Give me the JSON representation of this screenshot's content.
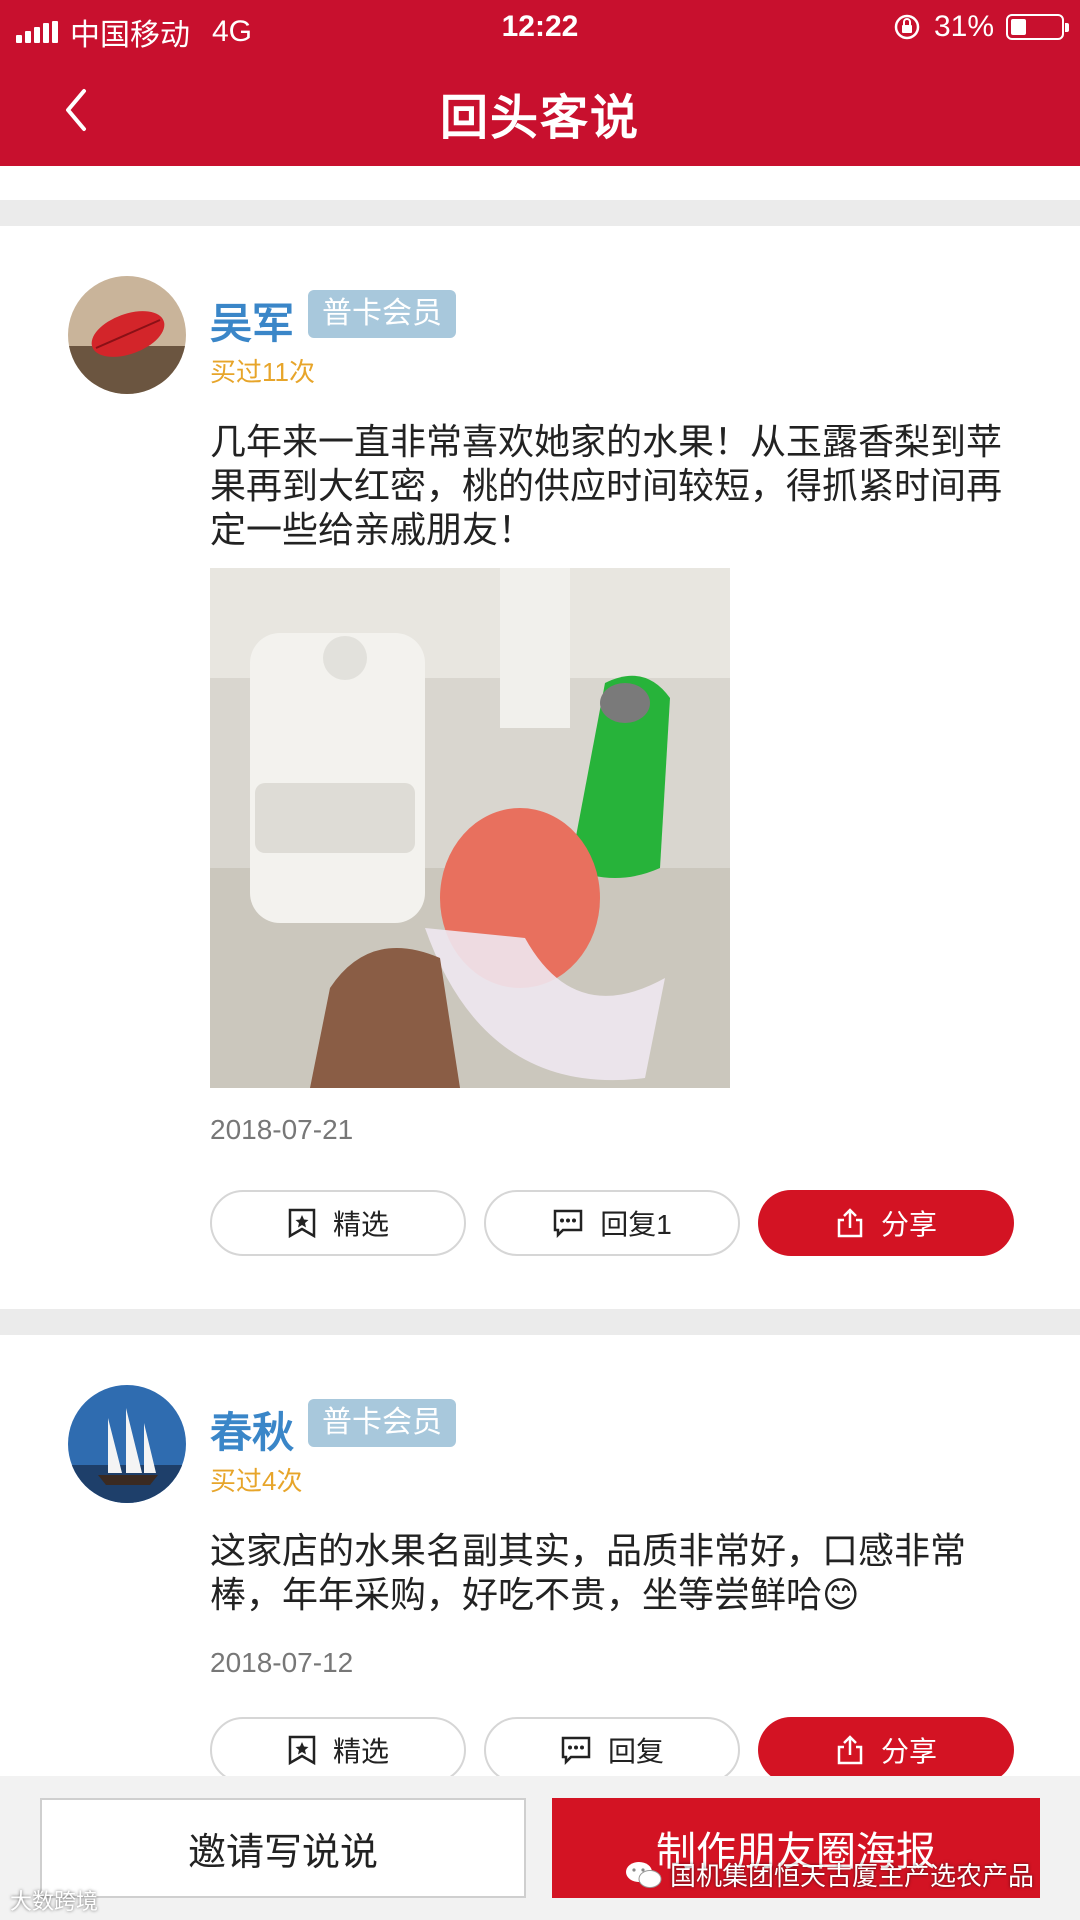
{
  "status_bar": {
    "carrier": "中国移动",
    "network": "4G",
    "time": "12:22",
    "battery_text": "31%",
    "battery_level": 0.31
  },
  "header": {
    "title": "回头客说",
    "back_icon": "chevron-left-icon"
  },
  "colors": {
    "brand_red": "#c8102e",
    "button_red": "#d31323",
    "name_blue": "#3a86c8",
    "badge_blue": "#a8c8dc",
    "bought_orange": "#e7a52a"
  },
  "reviews": [
    {
      "name": "吴军",
      "badge": "普卡会员",
      "bought": "买过11次",
      "content": "几年来一直非常喜欢她家的水果！从玉露香梨到苹果再到大红密，桃的供应时间较短，得抓紧时间再定一些给亲戚朋友！",
      "date": "2018-07-21",
      "buttons": {
        "feature": "精选",
        "reply": "回复1",
        "share": "分享"
      }
    },
    {
      "name": "春秋",
      "badge": "普卡会员",
      "bought": "买过4次",
      "content": "这家店的水果名副其实，品质非常好，口感非常棒，年年采购，好吃不贵，坐等尝鲜哈😊",
      "date": "2018-07-12",
      "buttons": {
        "feature": "精选",
        "reply": "回复",
        "share": "分享"
      }
    }
  ],
  "bottom": {
    "invite": "邀请写说说",
    "poster": "制作朋友圈海报"
  },
  "watermark": {
    "text": "国机集团恒天古厦主产选农产品",
    "left_text": "大数跨境"
  }
}
